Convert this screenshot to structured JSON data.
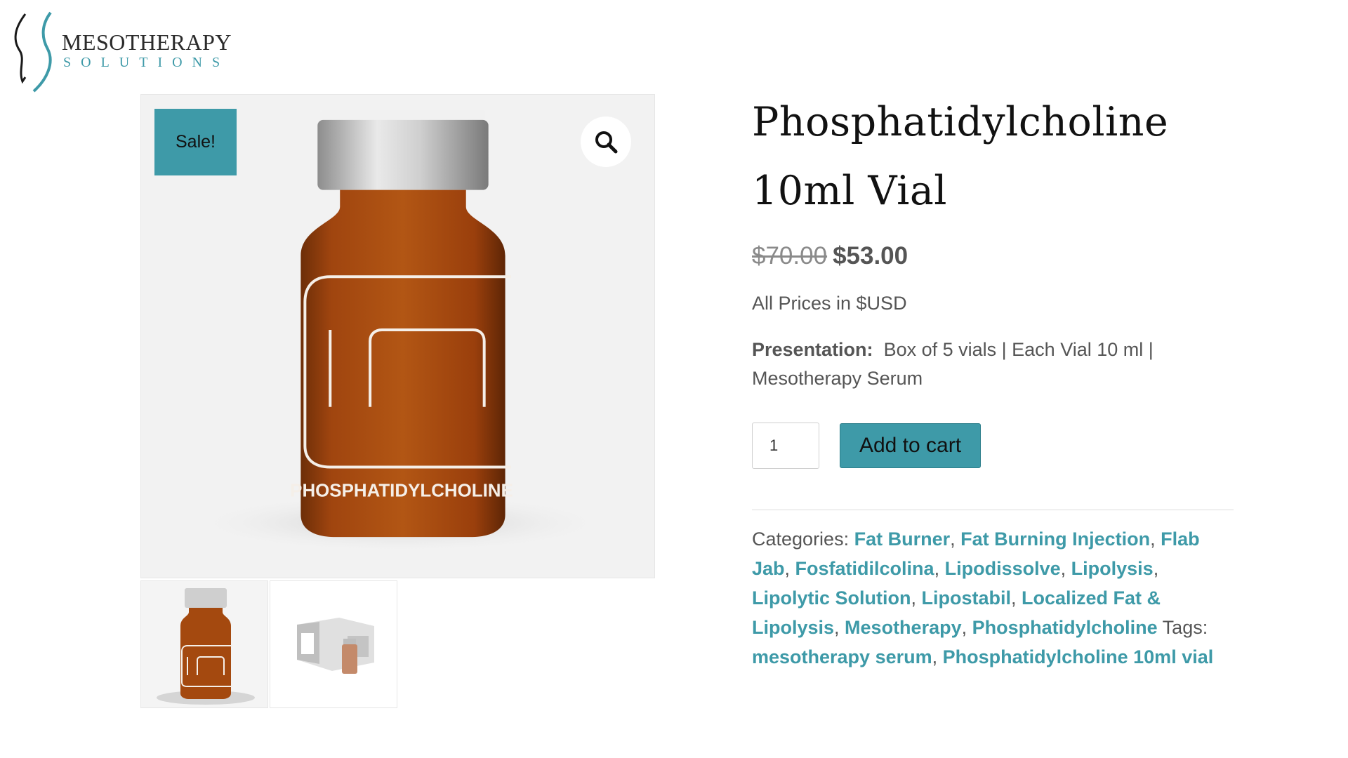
{
  "brand": {
    "name": "MESOTHERAPY",
    "tagline": "SOLUTIONS",
    "accent": "#3e9aa8"
  },
  "gallery": {
    "sale_label": "Sale!",
    "zoom_icon": "search-icon",
    "vial_label": "PHOSPHATIDYLCHOLINE",
    "thumbnails": [
      "vial-thumbnail",
      "box-thumbnail"
    ]
  },
  "product": {
    "title_line1": "Phosphatidylcholine",
    "title_line2": "10ml Vial",
    "price_old": "$70.00",
    "price_new": "$53.00",
    "currency_note": "All Prices in $USD",
    "presentation_label": "Presentation:",
    "presentation_value": "Box of 5 vials | Each Vial 10 ml |",
    "presentation_value2": "Mesotherapy Serum",
    "quantity": "1",
    "add_to_cart": "Add to cart"
  },
  "meta": {
    "categories_label": "Categories:",
    "categories": [
      "Fat Burner",
      "Fat Burning Injection",
      "Flab Jab",
      "Fosfatidilcolina",
      "Lipodissolve",
      "Lipolysis",
      "Lipolytic Solution",
      "Lipostabil",
      "Localized Fat & Lipolysis",
      "Mesotherapy",
      "Phosphatidylcholine"
    ],
    "tags_label": "Tags:",
    "tags": [
      "mesotherapy serum",
      "Phosphatidylcholine 10ml vial"
    ]
  }
}
